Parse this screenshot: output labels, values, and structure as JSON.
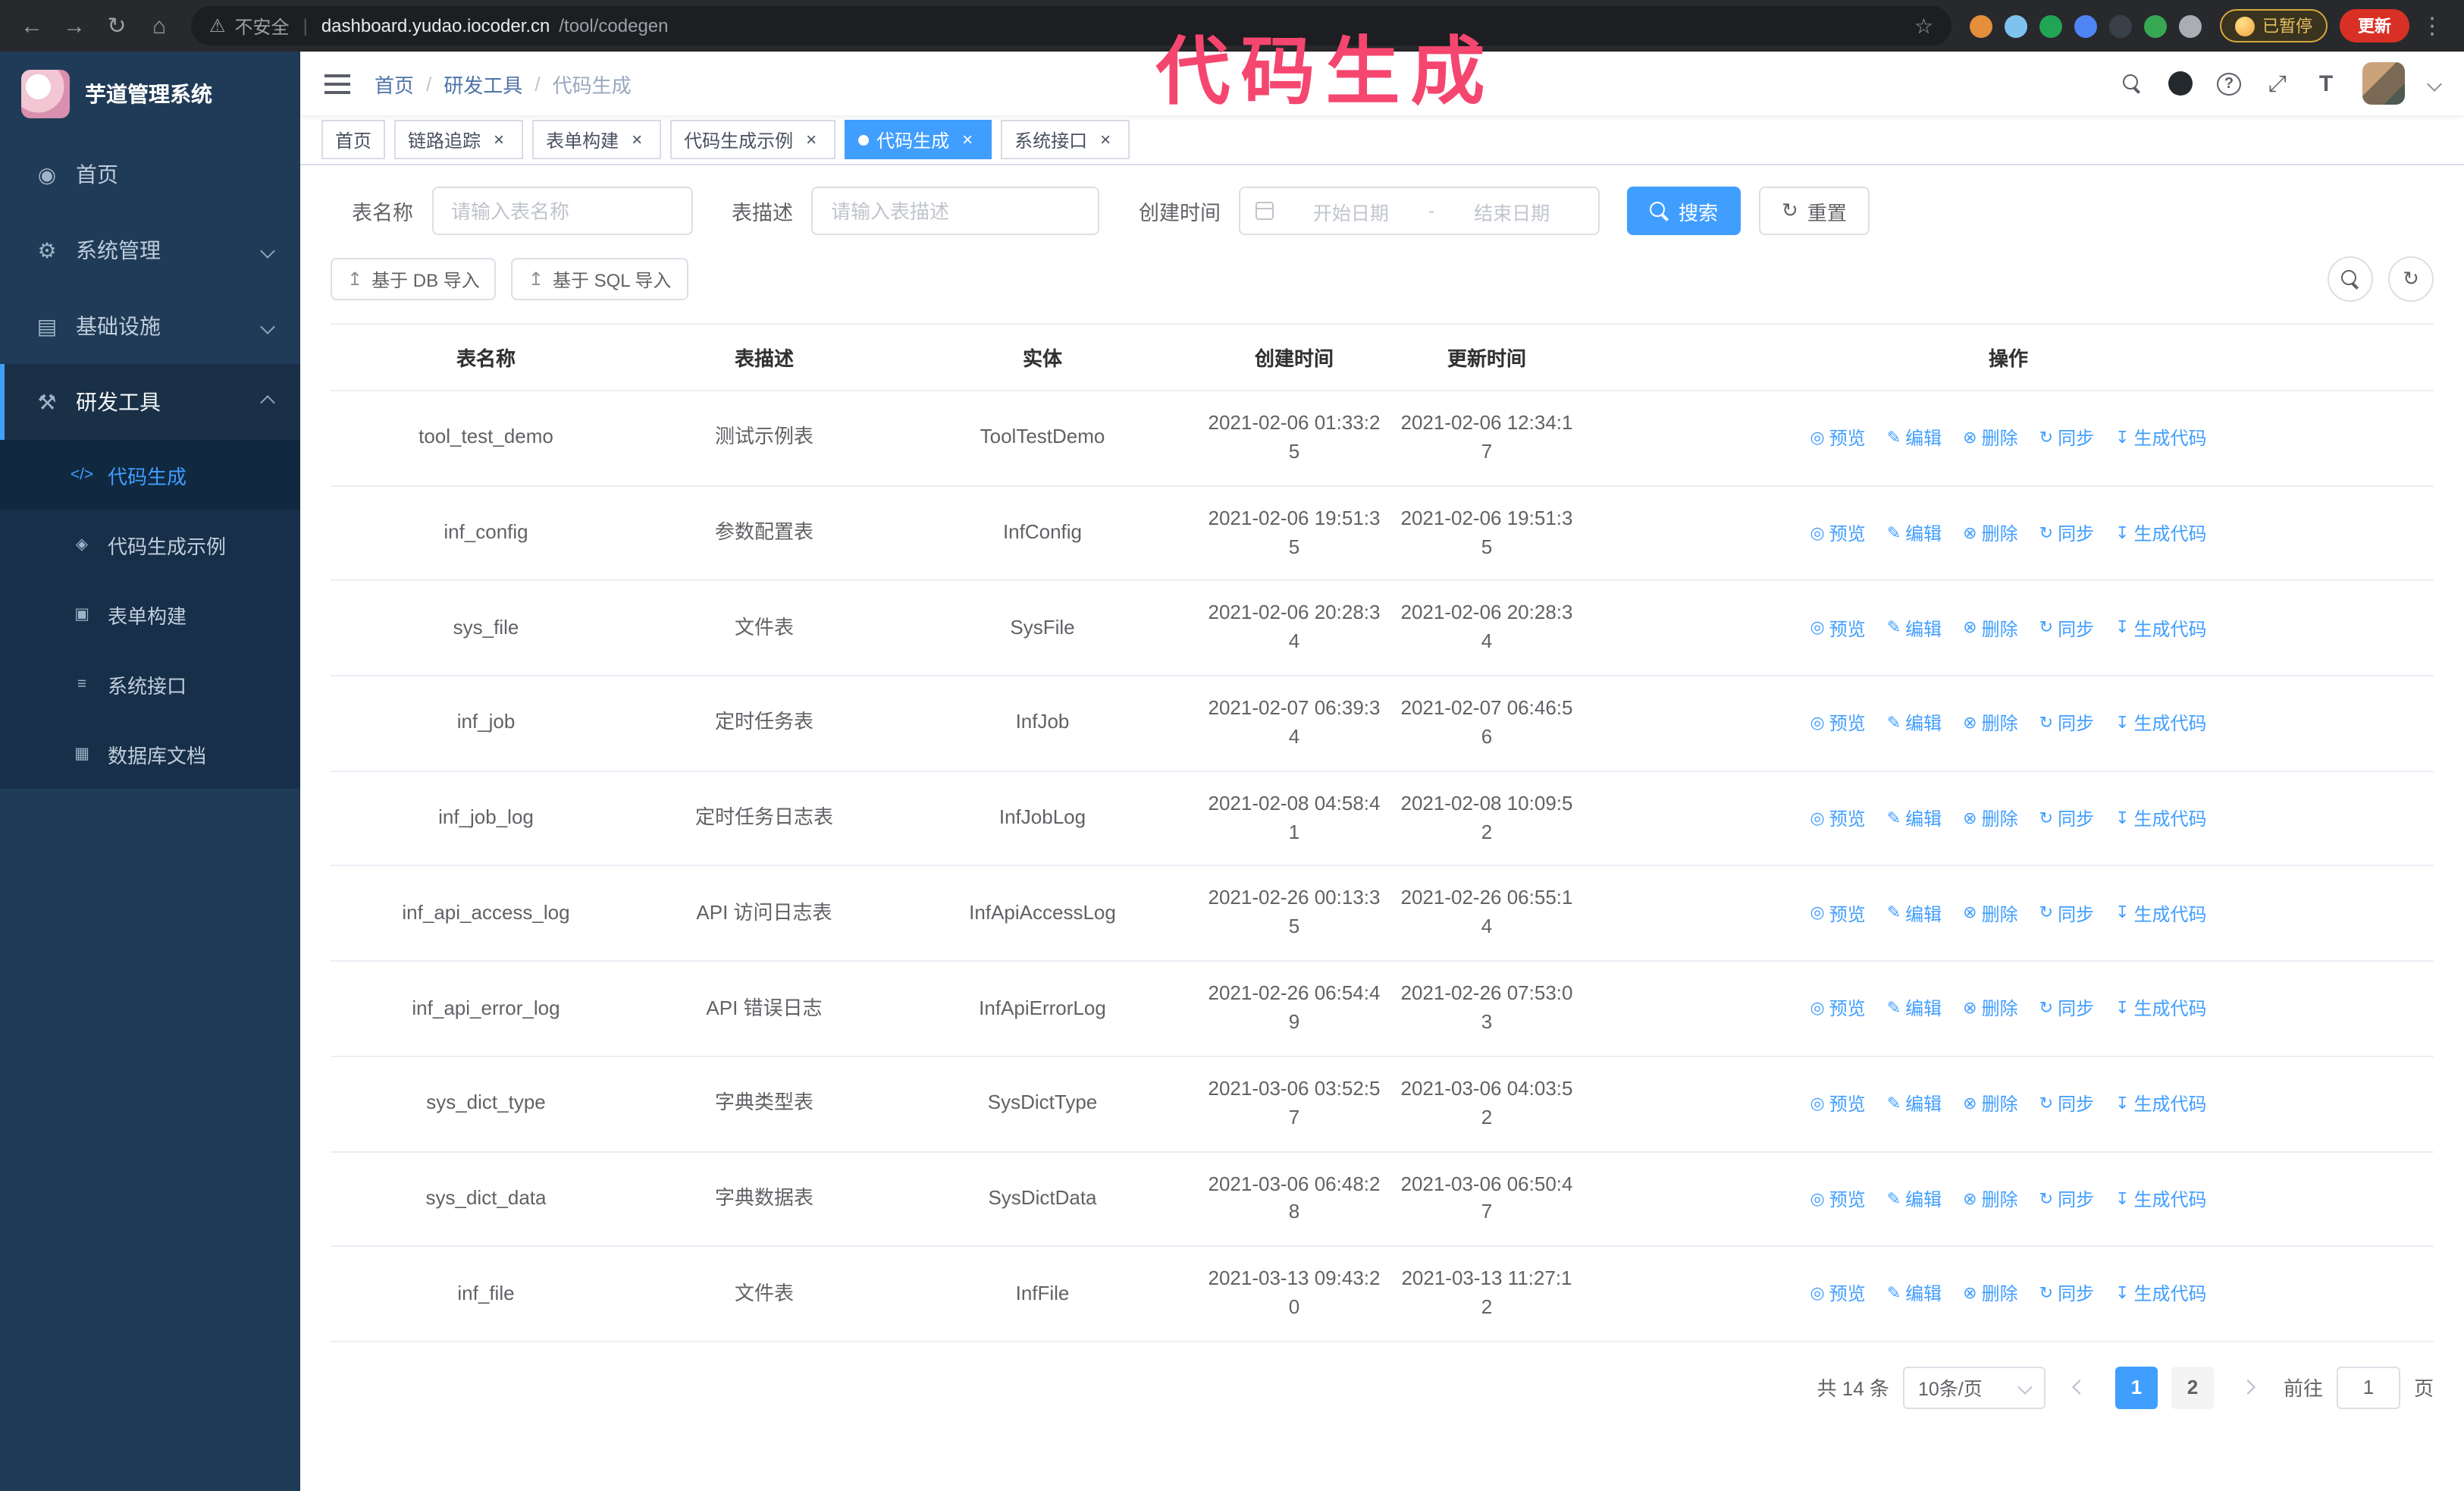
{
  "annotation": {
    "text": "代码生成",
    "color": "#f5466f"
  },
  "icons": {
    "close": "×",
    "refresh": "↻",
    "upload": "↥",
    "fullscreen": "⤢",
    "font_size": "T",
    "question": "?"
  },
  "browser": {
    "icons": {
      "back": "←",
      "forward": "→",
      "reload": "↻",
      "home": "⌂",
      "warning": "⚠",
      "divider": "|",
      "star": "☆",
      "menu": "⋮"
    },
    "security_label": "不安全",
    "url_domain": "dashboard.yudao.iocoder.cn",
    "url_path": "/tool/codegen",
    "extension_colors": [
      "#e58e3b",
      "#7ec3f0",
      "#21a453",
      "#4f84f5",
      "#3a4049",
      "#36a854",
      "#a9adb4"
    ],
    "paused_badge": "已暂停",
    "update_button": "更新"
  },
  "sidebar": {
    "logo_title": "芋道管理系统",
    "menu": [
      {
        "label": "首页",
        "icon": "home-icon",
        "glyph": "◉"
      },
      {
        "label": "系统管理",
        "icon": "gear-icon",
        "glyph": "⚙",
        "chevron": "down"
      },
      {
        "label": "基础设施",
        "icon": "infra-icon",
        "glyph": "▤",
        "chevron": "down"
      },
      {
        "label": "研发工具",
        "icon": "tools-icon",
        "glyph": "⚒",
        "chevron": "up",
        "active": true
      }
    ],
    "submenu": [
      {
        "label": "代码生成",
        "icon": "code-icon",
        "glyph": "</>",
        "active": true
      },
      {
        "label": "代码生成示例",
        "icon": "example-icon",
        "glyph": "◈"
      },
      {
        "label": "表单构建",
        "icon": "form-icon",
        "glyph": "▣"
      },
      {
        "label": "系统接口",
        "icon": "api-icon",
        "glyph": "≡"
      },
      {
        "label": "数据库文档",
        "icon": "db-doc-icon",
        "glyph": "▦"
      }
    ]
  },
  "header": {
    "breadcrumb": [
      "首页",
      "研发工具",
      "代码生成"
    ],
    "separator": "/"
  },
  "tabs": [
    {
      "label": "首页",
      "closable": false,
      "active": false
    },
    {
      "label": "链路追踪",
      "closable": true,
      "active": false
    },
    {
      "label": "表单构建",
      "closable": true,
      "active": false
    },
    {
      "label": "代码生成示例",
      "closable": true,
      "active": false
    },
    {
      "label": "代码生成",
      "closable": true,
      "active": true
    },
    {
      "label": "系统接口",
      "closable": true,
      "active": false
    }
  ],
  "filters": {
    "table_name_label": "表名称",
    "table_name_placeholder": "请输入表名称",
    "table_desc_label": "表描述",
    "table_desc_placeholder": "请输入表描述",
    "create_time_label": "创建时间",
    "start_date_placeholder": "开始日期",
    "range_separator": "-",
    "end_date_placeholder": "结束日期",
    "search_button": "搜索",
    "reset_button": "重置"
  },
  "toolbar": {
    "import_db": "基于 DB 导入",
    "import_sql": "基于 SQL 导入"
  },
  "table": {
    "columns": [
      "表名称",
      "表描述",
      "实体",
      "创建时间",
      "更新时间",
      "操作"
    ],
    "actions": [
      {
        "name": "preview",
        "label": "预览",
        "glyph": "◎"
      },
      {
        "name": "edit",
        "label": "编辑",
        "glyph": "✎"
      },
      {
        "name": "delete",
        "label": "删除",
        "glyph": "⊗"
      },
      {
        "name": "sync",
        "label": "同步",
        "glyph": "↻"
      },
      {
        "name": "generate",
        "label": "生成代码",
        "glyph": "↧"
      }
    ],
    "rows": [
      {
        "name": "tool_test_demo",
        "desc": "测试示例表",
        "entity": "ToolTestDemo",
        "created": "2021-02-06 01:33:25",
        "updated": "2021-02-06 12:34:17"
      },
      {
        "name": "inf_config",
        "desc": "参数配置表",
        "entity": "InfConfig",
        "created": "2021-02-06 19:51:35",
        "updated": "2021-02-06 19:51:35"
      },
      {
        "name": "sys_file",
        "desc": "文件表",
        "entity": "SysFile",
        "created": "2021-02-06 20:28:34",
        "updated": "2021-02-06 20:28:34"
      },
      {
        "name": "inf_job",
        "desc": "定时任务表",
        "entity": "InfJob",
        "created": "2021-02-07 06:39:34",
        "updated": "2021-02-07 06:46:56"
      },
      {
        "name": "inf_job_log",
        "desc": "定时任务日志表",
        "entity": "InfJobLog",
        "created": "2021-02-08 04:58:41",
        "updated": "2021-02-08 10:09:52"
      },
      {
        "name": "inf_api_access_log",
        "desc": "API 访问日志表",
        "entity": "InfApiAccessLog",
        "created": "2021-02-26 00:13:35",
        "updated": "2021-02-26 06:55:14"
      },
      {
        "name": "inf_api_error_log",
        "desc": "API 错误日志",
        "entity": "InfApiErrorLog",
        "created": "2021-02-26 06:54:49",
        "updated": "2021-02-26 07:53:03"
      },
      {
        "name": "sys_dict_type",
        "desc": "字典类型表",
        "entity": "SysDictType",
        "created": "2021-03-06 03:52:57",
        "updated": "2021-03-06 04:03:52"
      },
      {
        "name": "sys_dict_data",
        "desc": "字典数据表",
        "entity": "SysDictData",
        "created": "2021-03-06 06:48:28",
        "updated": "2021-03-06 06:50:47"
      },
      {
        "name": "inf_file",
        "desc": "文件表",
        "entity": "InfFile",
        "created": "2021-03-13 09:43:20",
        "updated": "2021-03-13 11:27:12"
      }
    ]
  },
  "pagination": {
    "total": "共 14 条",
    "page_size": "10条/页",
    "pages": [
      "1",
      "2"
    ],
    "current": "1",
    "goto_label": "前往",
    "goto_value": "1",
    "unit_label": "页"
  }
}
